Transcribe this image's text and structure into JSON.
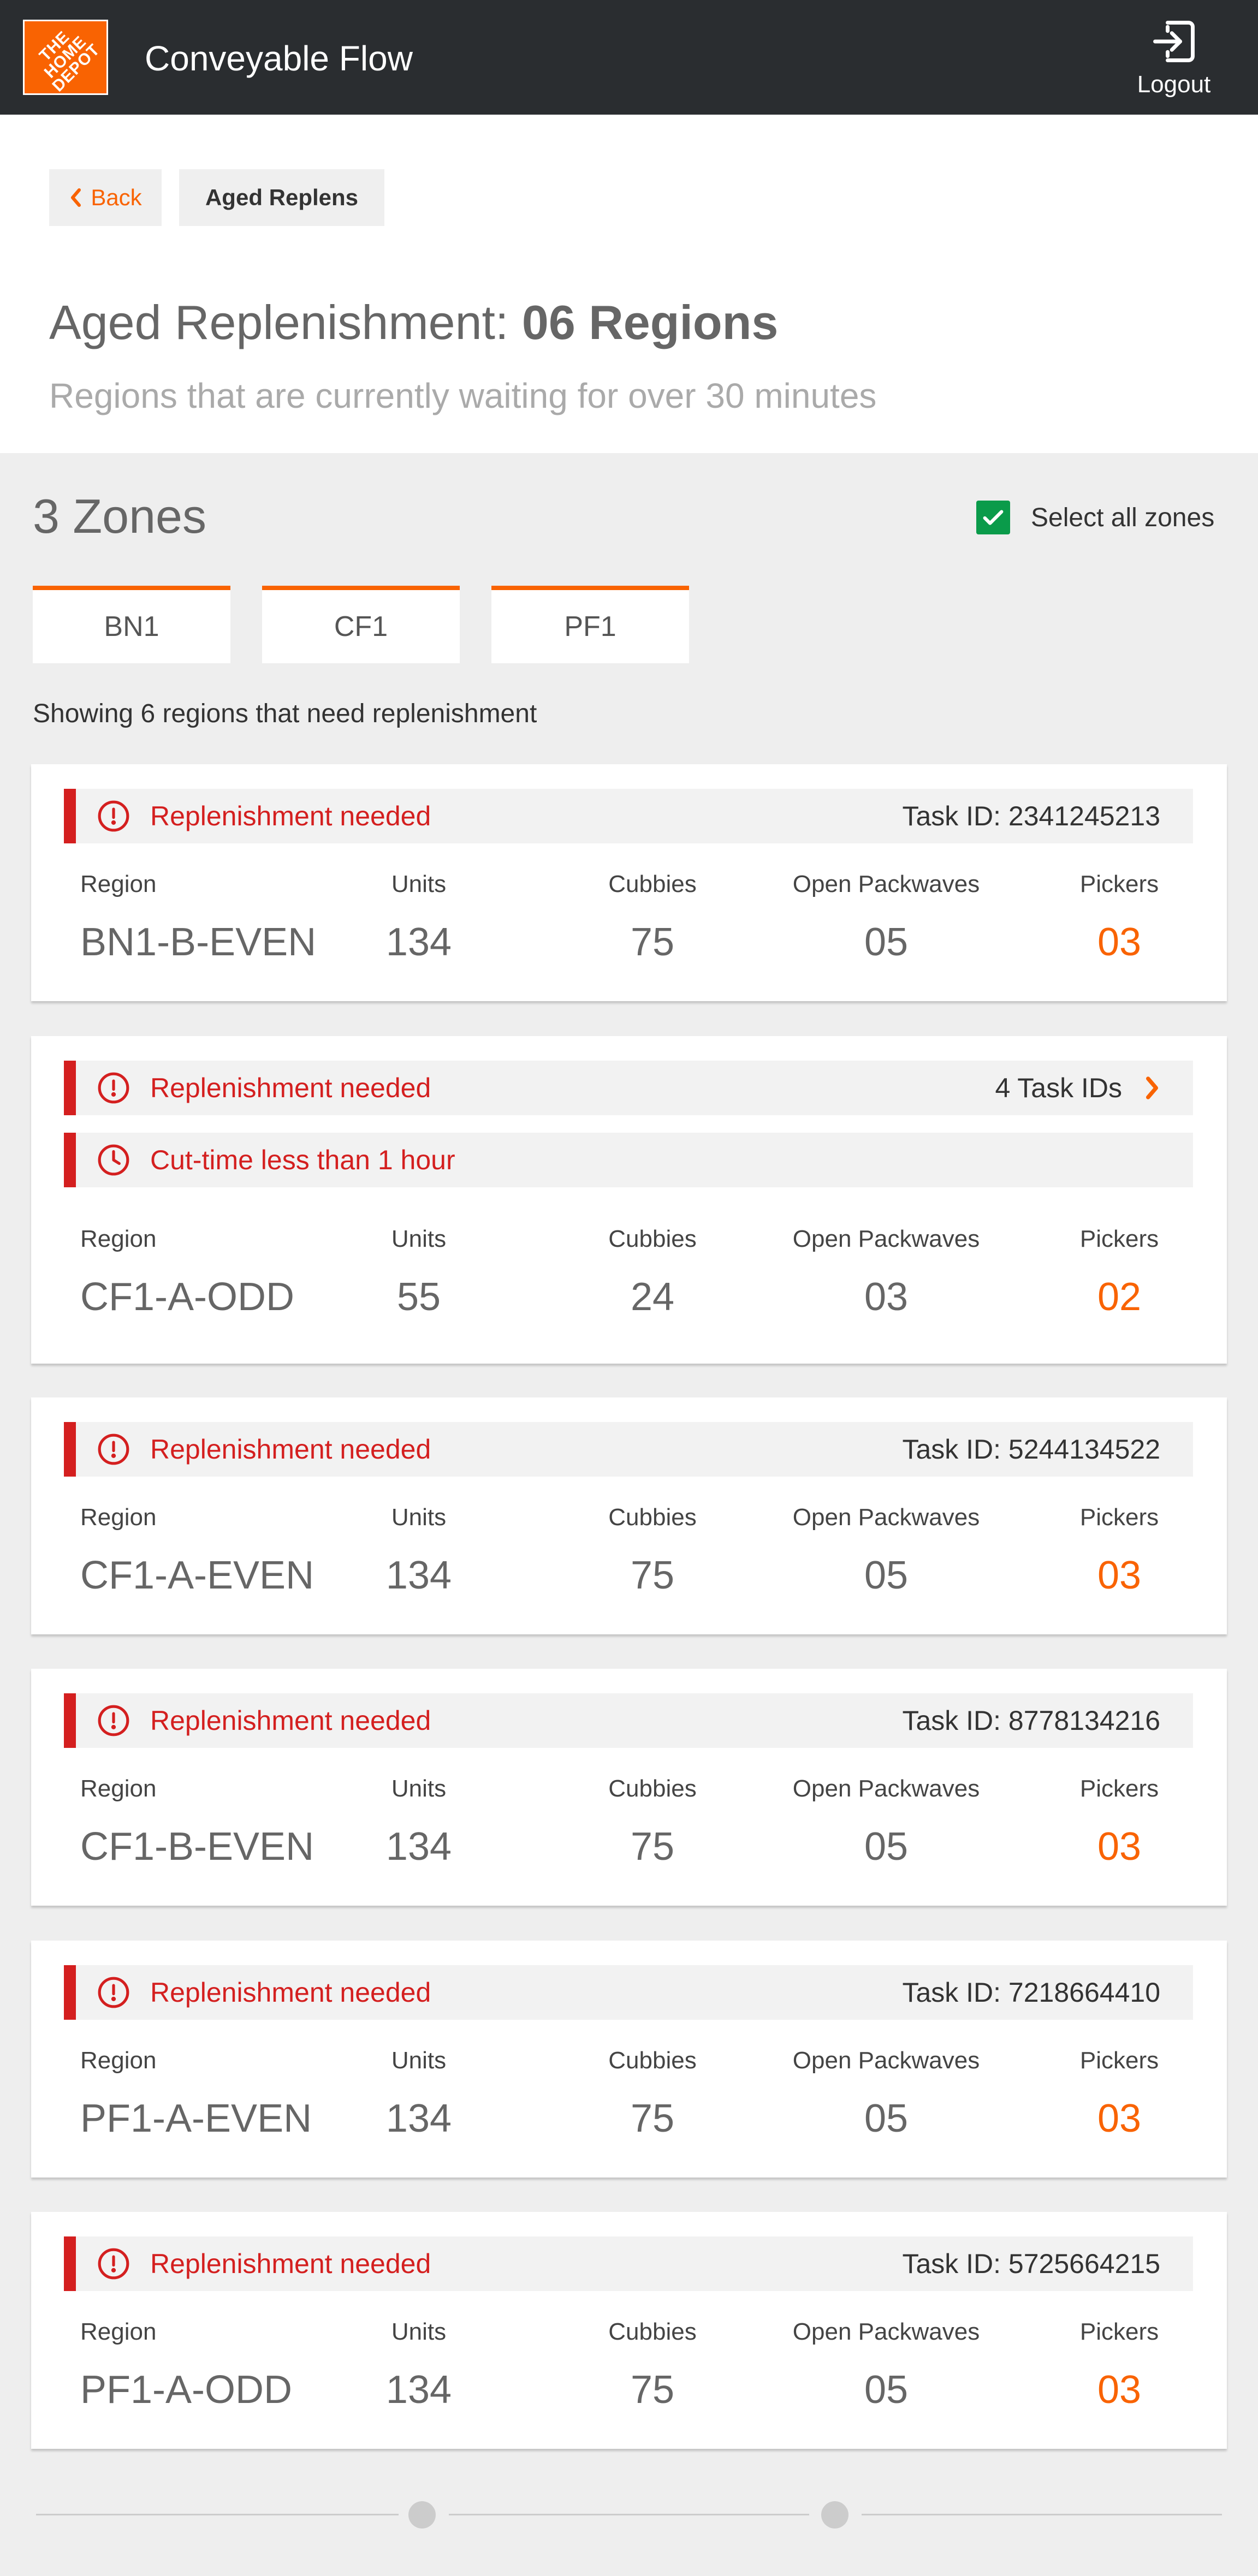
{
  "header": {
    "logo_text": "THE HOME DEPOT",
    "title": "Conveyable Flow",
    "logout_label": "Logout"
  },
  "nav": {
    "back_label": "Back",
    "crumb_label": "Aged Replens"
  },
  "page": {
    "title_prefix": "Aged Replenishment: ",
    "title_count": "06 Regions",
    "subtitle": "Regions that are currently waiting for over 30 minutes"
  },
  "zones": {
    "title": "3 Zones",
    "select_all_label": "Select all zones",
    "select_all_checked": true,
    "tabs": [
      "BN1",
      "CF1",
      "PF1"
    ],
    "showing_text": "Showing 6 regions that need replenishment"
  },
  "labels": {
    "region": "Region",
    "units": "Units",
    "cubbies": "Cubbies",
    "open_packwaves": "Open Packwaves",
    "pickers": "Pickers"
  },
  "cards": [
    {
      "alerts": [
        {
          "icon": "exclamation-circle-icon",
          "text": "Replenishment needed",
          "right": "Task ID: 2341245213"
        }
      ],
      "region": "BN1-B-EVEN",
      "units": "134",
      "cubbies": "75",
      "open_packwaves": "05",
      "pickers": "03"
    },
    {
      "alerts": [
        {
          "icon": "exclamation-circle-icon",
          "text": "Replenishment needed",
          "right": "4 Task IDs"
        },
        {
          "icon": "clock-icon",
          "text": "Cut-time less than 1 hour",
          "right": ""
        }
      ],
      "region": "CF1-A-ODD",
      "units": "55",
      "cubbies": "24",
      "open_packwaves": "03",
      "pickers": "02"
    },
    {
      "alerts": [
        {
          "icon": "exclamation-circle-icon",
          "text": "Replenishment needed",
          "right": "Task ID: 5244134522"
        }
      ],
      "region": "CF1-A-EVEN",
      "units": "134",
      "cubbies": "75",
      "open_packwaves": "05",
      "pickers": "03"
    },
    {
      "alerts": [
        {
          "icon": "exclamation-circle-icon",
          "text": "Replenishment needed",
          "right": "Task ID: 8778134216"
        }
      ],
      "region": "CF1-B-EVEN",
      "units": "134",
      "cubbies": "75",
      "open_packwaves": "05",
      "pickers": "03"
    },
    {
      "alerts": [
        {
          "icon": "exclamation-circle-icon",
          "text": "Replenishment needed",
          "right": "Task ID: 7218664410"
        }
      ],
      "region": "PF1-A-EVEN",
      "units": "134",
      "cubbies": "75",
      "open_packwaves": "05",
      "pickers": "03"
    },
    {
      "alerts": [
        {
          "icon": "exclamation-circle-icon",
          "text": "Replenishment needed",
          "right": "Task ID: 5725664215"
        }
      ],
      "region": "PF1-A-ODD",
      "units": "134",
      "cubbies": "75",
      "open_packwaves": "05",
      "pickers": "03"
    }
  ],
  "colors": {
    "brand_orange": "#f96302",
    "alert_red": "#d41f1f",
    "header_dark": "#2a2d30",
    "check_green": "#0a9b4a"
  }
}
